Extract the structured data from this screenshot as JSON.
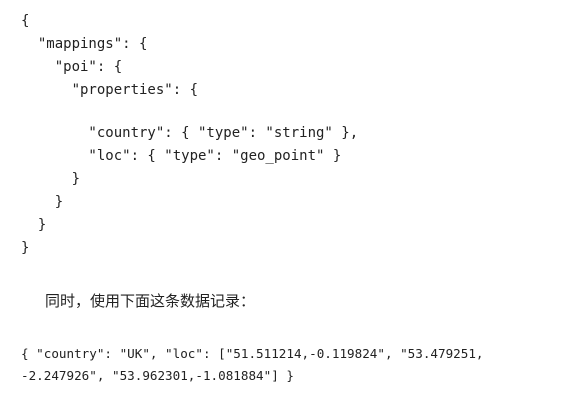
{
  "mapping_code": {
    "lines": [
      "{",
      "  \"mappings\": {",
      "    \"poi\": {",
      "      \"properties\": {",
      "",
      "        \"country\": { \"type\": \"string\" },",
      "        \"loc\": { \"type\": \"geo_point\" }",
      "      }",
      "    }",
      "  }",
      "}"
    ]
  },
  "prose": {
    "text": "同时，使用下面这条数据记录："
  },
  "record_code": {
    "lines": [
      "{ \"country\": \"UK\", \"loc\": [\"51.511214,-0.119824\", \"53.479251,",
      "-2.247926\", \"53.962301,-1.081884\"] }"
    ]
  }
}
